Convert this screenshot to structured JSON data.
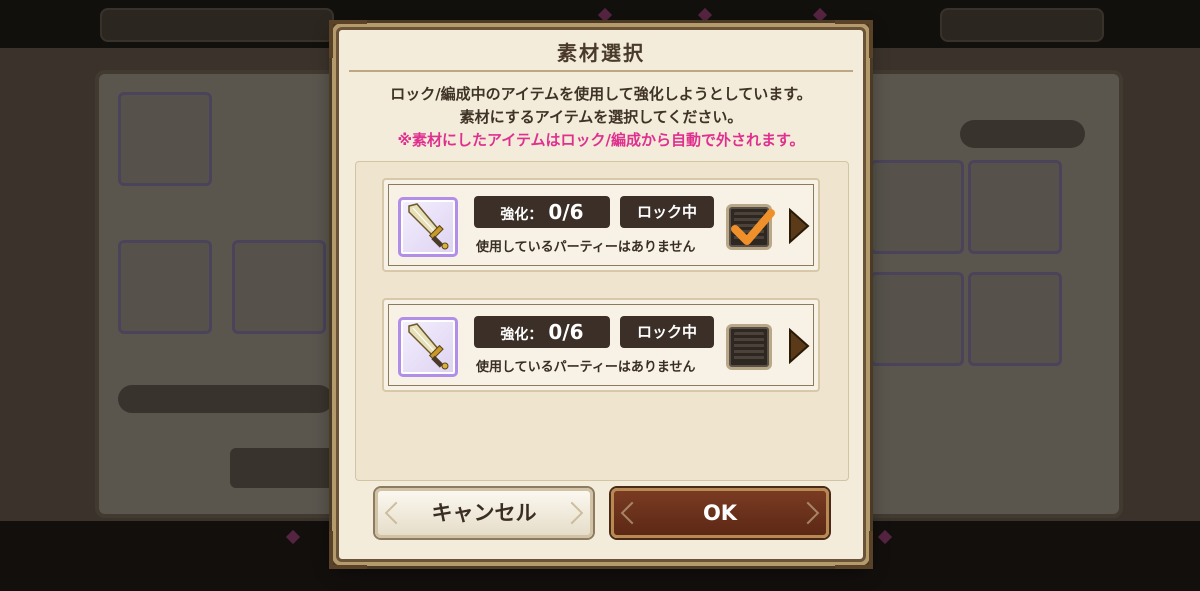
{
  "dialog": {
    "title": "素材選択",
    "message_line1": "ロック/編成中のアイテムを使用して強化しようとしています。",
    "message_line2": "素材にするアイテムを選択してください。",
    "warning": "※素材にしたアイテムはロック/編成から自動で外されます。"
  },
  "items": [
    {
      "icon": "sword-icon",
      "enhance_label": "強化：",
      "enhance_value": "0/6",
      "lock_label": "ロック中",
      "party_text": "使用しているパーティーはありません",
      "checked": true
    },
    {
      "icon": "sword-icon",
      "enhance_label": "強化：",
      "enhance_value": "0/6",
      "lock_label": "ロック中",
      "party_text": "使用しているパーティーはありません",
      "checked": false
    }
  ],
  "buttons": {
    "cancel": "キャンセル",
    "ok": "OK"
  },
  "colors": {
    "dialog_bg": "#f3ecda",
    "warning_text": "#e0308f",
    "check_mark": "#f0902a",
    "ok_button": "#6a3019",
    "item_frame": "#b18ee8"
  }
}
